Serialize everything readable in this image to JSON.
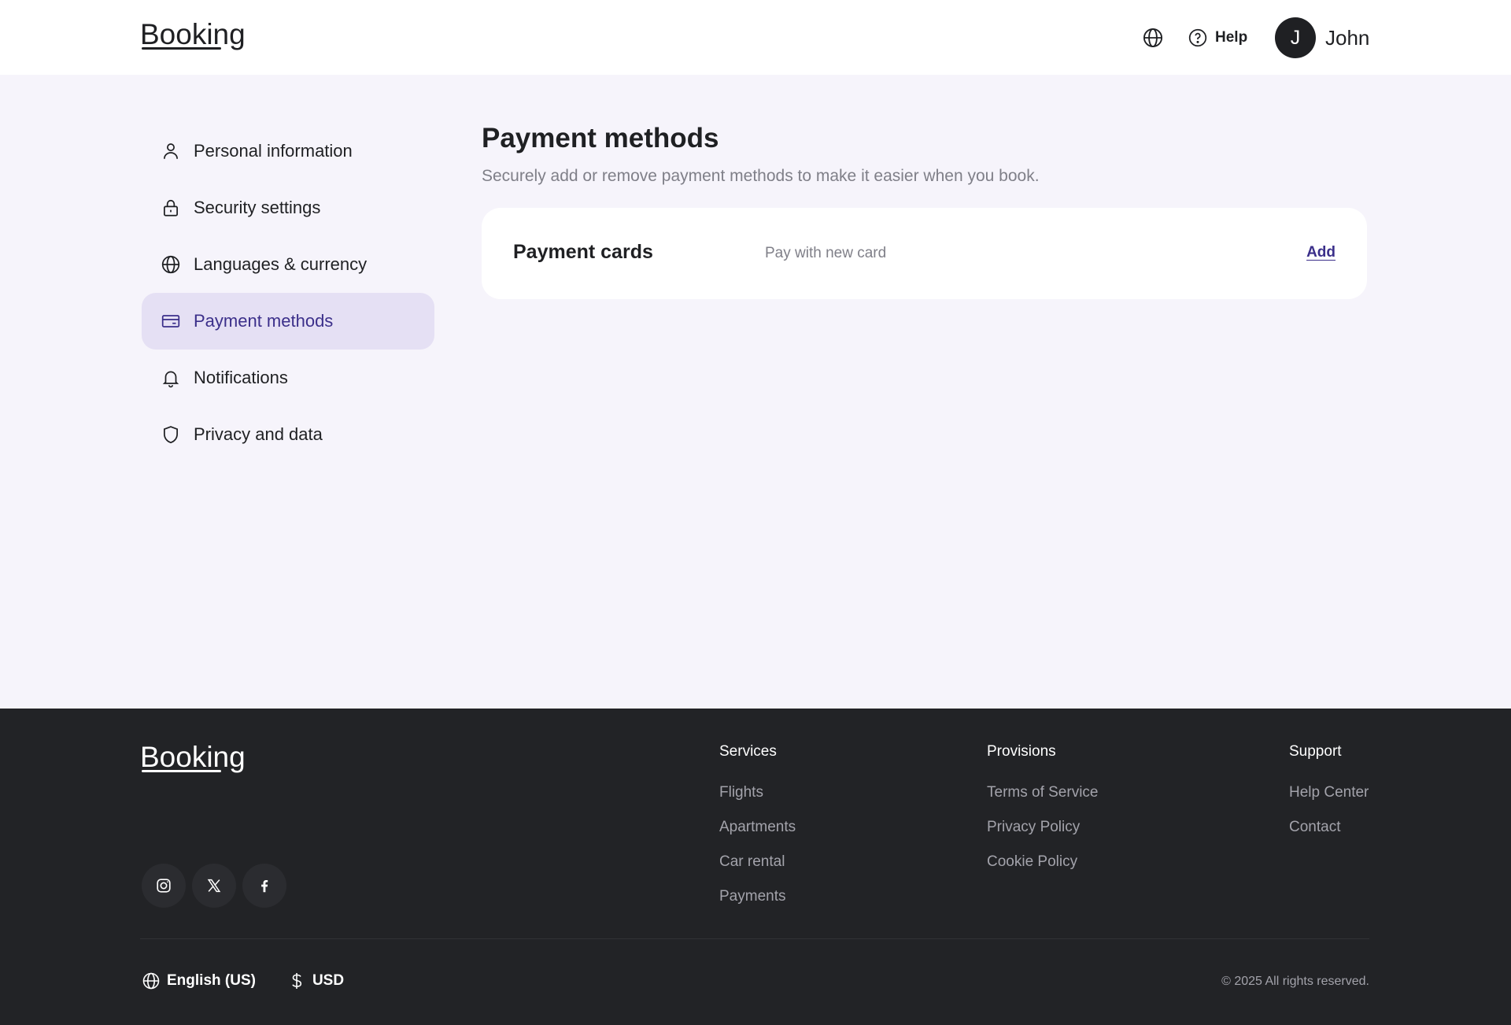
{
  "header": {
    "logo": "Booking",
    "help_label": "Help",
    "user_initial": "J",
    "user_name": "John"
  },
  "sidebar": {
    "items": [
      {
        "label": "Personal information",
        "icon": "user-icon"
      },
      {
        "label": "Security settings",
        "icon": "lock-icon"
      },
      {
        "label": "Languages & currency",
        "icon": "globe-icon"
      },
      {
        "label": "Payment methods",
        "icon": "credit-card-icon",
        "active": true
      },
      {
        "label": "Notifications",
        "icon": "bell-icon"
      },
      {
        "label": "Privacy and data",
        "icon": "shield-icon"
      }
    ]
  },
  "main": {
    "title": "Payment methods",
    "subtitle": "Securely add or remove payment methods to make it easier when you book.",
    "card": {
      "title": "Payment cards",
      "description": "Pay with new card",
      "action": "Add"
    }
  },
  "footer": {
    "logo": "Booking",
    "columns": [
      {
        "heading": "Services",
        "links": [
          "Flights",
          "Apartments",
          "Car rental",
          "Payments"
        ]
      },
      {
        "heading": "Provisions",
        "links": [
          "Terms of Service",
          "Privacy Policy",
          "Cookie Policy"
        ]
      },
      {
        "heading": "Support",
        "links": [
          "Help Center",
          "Contact"
        ]
      }
    ],
    "socials": [
      "instagram-icon",
      "x-icon",
      "facebook-icon"
    ],
    "language": "English (US)",
    "currency": "USD",
    "copyright": "© 2025 All rights reserved."
  },
  "colors": {
    "accent": "#3b2f8a",
    "active_bg": "#e5e0f4",
    "page_bg": "#f6f4fb",
    "footer_bg": "#222326"
  }
}
